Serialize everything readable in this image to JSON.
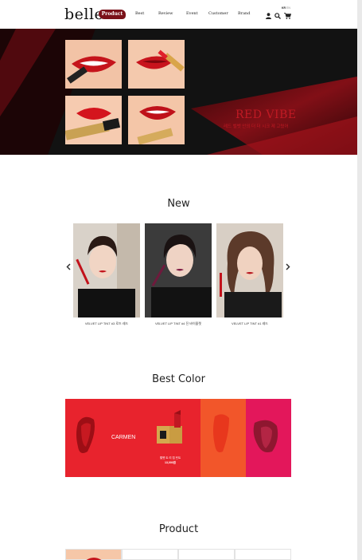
{
  "header": {
    "logo": "belle",
    "nav_active": "Product",
    "nav": [
      "Best",
      "Review",
      "Event",
      "Customer",
      "Brand"
    ],
    "lang": [
      "KR",
      "EN"
    ],
    "icons": [
      "user-icon",
      "search-icon",
      "cart-icon"
    ]
  },
  "hero": {
    "title": "RED VIBE",
    "subtitle": "레드 벨벳 안의 더 더 시크 제 고렸어"
  },
  "new_section": {
    "title": "New",
    "items": [
      {
        "caption": "VELVET LIP TINT #3 로즈 레드"
      },
      {
        "caption": "VELVET LIP TINT #4 진 바이올렛"
      },
      {
        "caption": "VELVET LIP TINT #1 레드"
      }
    ]
  },
  "best_color": {
    "title": "Best Color",
    "feature_name": "CARMEN",
    "product_name": "벨벳 트 리 립 틴트",
    "price": "13,000원",
    "colors": [
      "#e8232d",
      "#f2562a",
      "#e3175b"
    ]
  },
  "product_section": {
    "title": "Product"
  },
  "colors": {
    "brand_red": "#7a1119",
    "hero_bg": "#141414",
    "hero_accent": "#c01a24"
  }
}
